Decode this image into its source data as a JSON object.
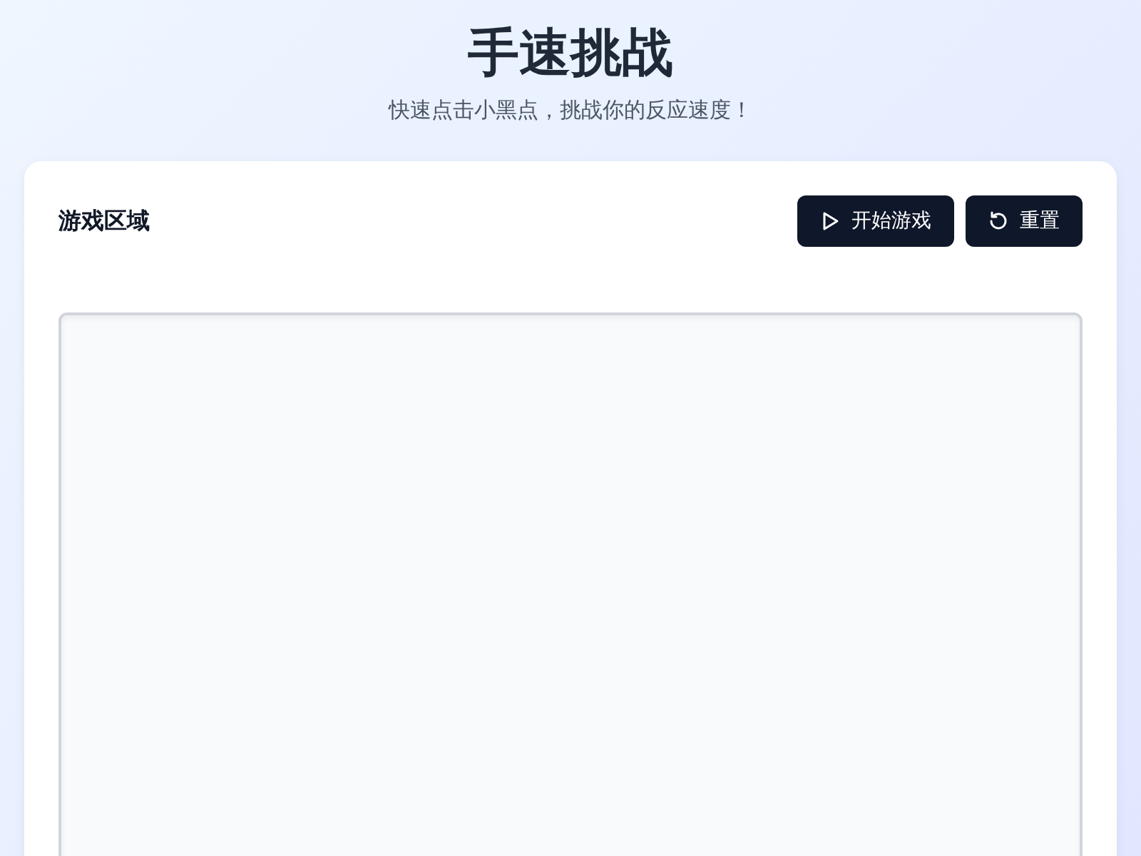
{
  "header": {
    "title": "手速挑战",
    "subtitle": "快速点击小黑点，挑战你的反应速度！"
  },
  "game_card": {
    "title": "游戏区域",
    "buttons": [
      {
        "label": "开始游戏",
        "kind": "start"
      },
      {
        "label": "重置",
        "kind": "reset"
      }
    ]
  }
}
